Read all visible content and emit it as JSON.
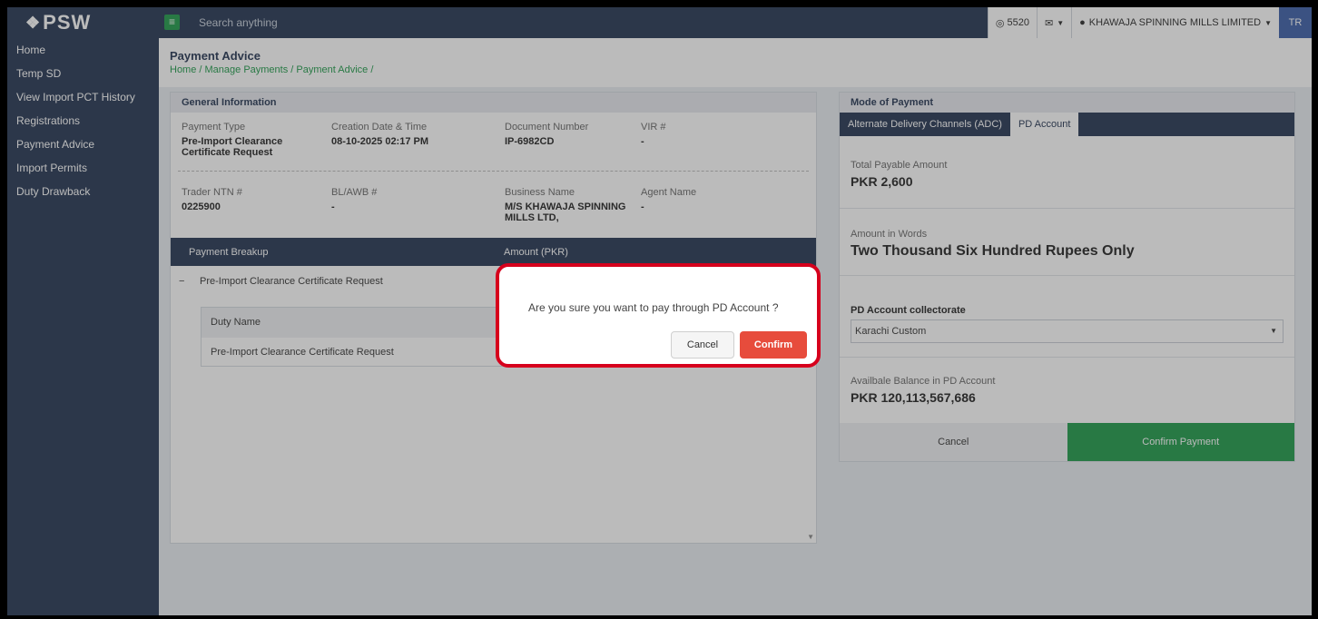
{
  "brand": {
    "name": "PSW"
  },
  "sidebar": {
    "items": [
      {
        "label": "Home"
      },
      {
        "label": "Temp SD"
      },
      {
        "label": "View Import PCT History"
      },
      {
        "label": "Registrations"
      },
      {
        "label": "Payment Advice"
      },
      {
        "label": "Import Permits"
      },
      {
        "label": "Duty Drawback"
      }
    ]
  },
  "topbar": {
    "search_placeholder": "Search anything",
    "points": "5520",
    "company": "KHAWAJA SPINNING MILLS LIMITED",
    "avatar": "TR"
  },
  "page": {
    "title": "Payment Advice",
    "breadcrumb": "Home / Manage Payments / Payment Advice /"
  },
  "general": {
    "title": "General Information",
    "row1": [
      {
        "label": "Payment Type",
        "value": "Pre-Import Clearance Certificate Request"
      },
      {
        "label": "Creation Date & Time",
        "value": "08-10-2025 02:17 PM"
      },
      {
        "label": "Document Number",
        "value": "IP-6982CD"
      },
      {
        "label": "VIR #",
        "value": "-"
      }
    ],
    "row2": [
      {
        "label": "Trader NTN #",
        "value": "0225900"
      },
      {
        "label": "BL/AWB #",
        "value": "-"
      },
      {
        "label": "Business Name",
        "value": "M/S KHAWAJA SPINNING MILLS LTD,"
      },
      {
        "label": "Agent Name",
        "value": "-"
      }
    ],
    "breakup_header": {
      "col1": "Payment Breakup",
      "col2": "Amount (PKR)"
    },
    "breakup_row": {
      "toggle": "−",
      "label": "Pre-Import Clearance Certificate Request"
    },
    "duty_header": "Duty Name",
    "duty_row": "Pre-Import Clearance Certificate Request"
  },
  "mop": {
    "title": "Mode of Payment",
    "tabs": [
      {
        "label": "Alternate Delivery Channels (ADC)"
      },
      {
        "label": "PD Account"
      }
    ],
    "total_label": "Total Payable Amount",
    "total_value": "PKR 2,600",
    "words_label": "Amount in Words",
    "words_value": "Two Thousand Six Hundred Rupees Only",
    "collectorate_label": "PD Account collectorate",
    "collectorate_value": "Karachi Custom",
    "balance_label": "Availbale Balance in PD Account",
    "balance_value": "PKR 120,113,567,686",
    "cancel_label": "Cancel",
    "confirm_label": "Confirm Payment"
  },
  "dialog": {
    "message": "Are you sure you want to pay through PD Account ?",
    "cancel_label": "Cancel",
    "confirm_label": "Confirm"
  },
  "colors": {
    "navy": "#243552",
    "green": "#1e9a49",
    "red": "#e74c3c",
    "highlight": "#d6001c"
  }
}
